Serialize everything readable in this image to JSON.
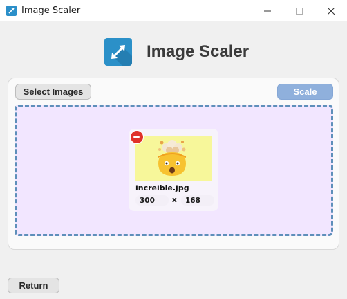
{
  "window": {
    "title": "Image Scaler",
    "controls": [
      "minimize-icon",
      "maximize-icon",
      "close-icon"
    ]
  },
  "header": {
    "logo_icon": "expand-arrows-icon",
    "title": "Image Scaler"
  },
  "toolbar": {
    "select_label": "Select Images",
    "scale_label": "Scale"
  },
  "images": [
    {
      "filename": "increible.jpg",
      "width": "300",
      "height": "168",
      "separator": "x",
      "remove_icon": "remove-icon",
      "thumbnail": "exploding-head-emoji"
    }
  ],
  "footer": {
    "return_label": "Return"
  },
  "colors": {
    "dropzone_bg": "#f2e6ff",
    "dropzone_border": "#5e8fba",
    "scale_button": "#8fb0dc",
    "remove_button": "#e0312a",
    "logo": "#2b90c8",
    "thumbnail_bg": "#f7f79a"
  }
}
